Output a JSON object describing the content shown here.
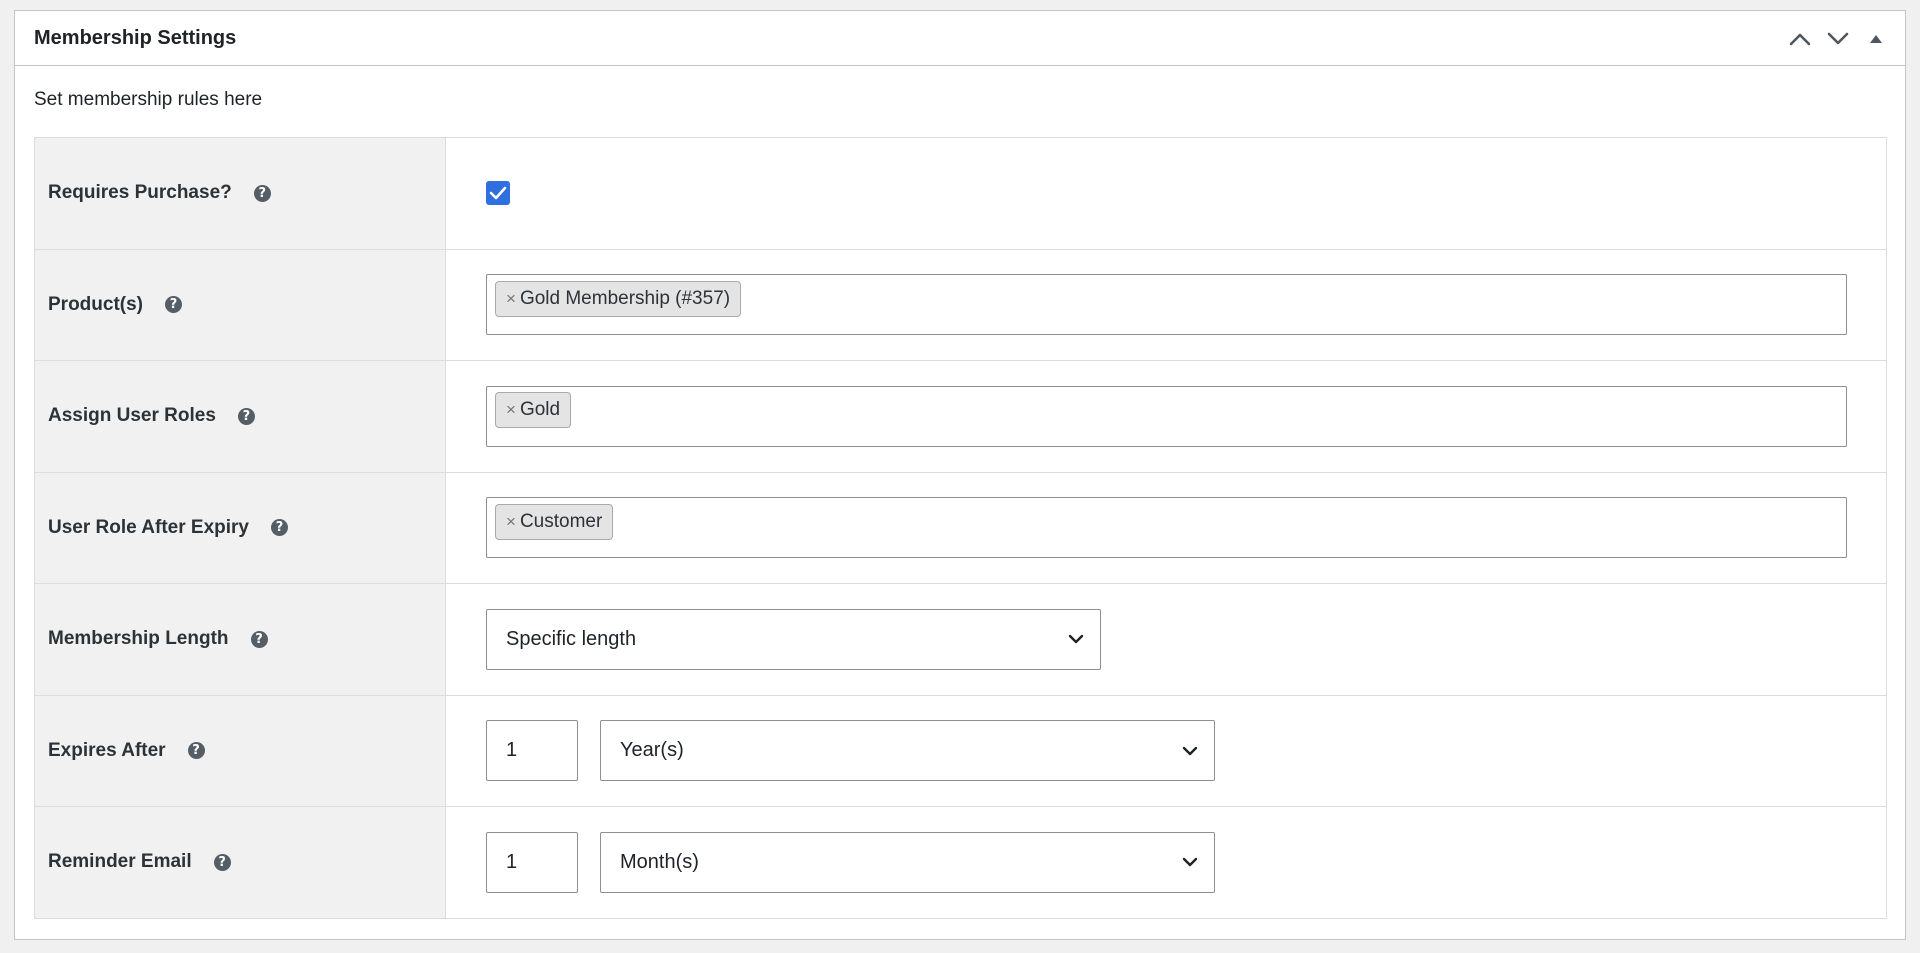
{
  "metabox": {
    "title": "Membership Settings",
    "description": "Set membership rules here"
  },
  "rows": {
    "requires_purchase": {
      "label": "Requires Purchase?",
      "checked": true
    },
    "products": {
      "label": "Product(s)",
      "tokens": [
        "Gold Membership (#357)"
      ]
    },
    "assign_roles": {
      "label": "Assign User Roles",
      "tokens": [
        "Gold"
      ]
    },
    "role_after_expiry": {
      "label": "User Role After Expiry",
      "tokens": [
        "Customer"
      ]
    },
    "membership_length": {
      "label": "Membership Length",
      "selected": "Specific length"
    },
    "expires_after": {
      "label": "Expires After",
      "number": "1",
      "unit": "Year(s)"
    },
    "reminder_email": {
      "label": "Reminder Email",
      "number": "1",
      "unit": "Month(s)"
    }
  },
  "icons": {
    "help": "question-circle-icon",
    "token_remove": "×",
    "help_glyph": "?"
  },
  "colors": {
    "accent": "#2f6fe0",
    "label_bg": "#f1f1f1"
  }
}
